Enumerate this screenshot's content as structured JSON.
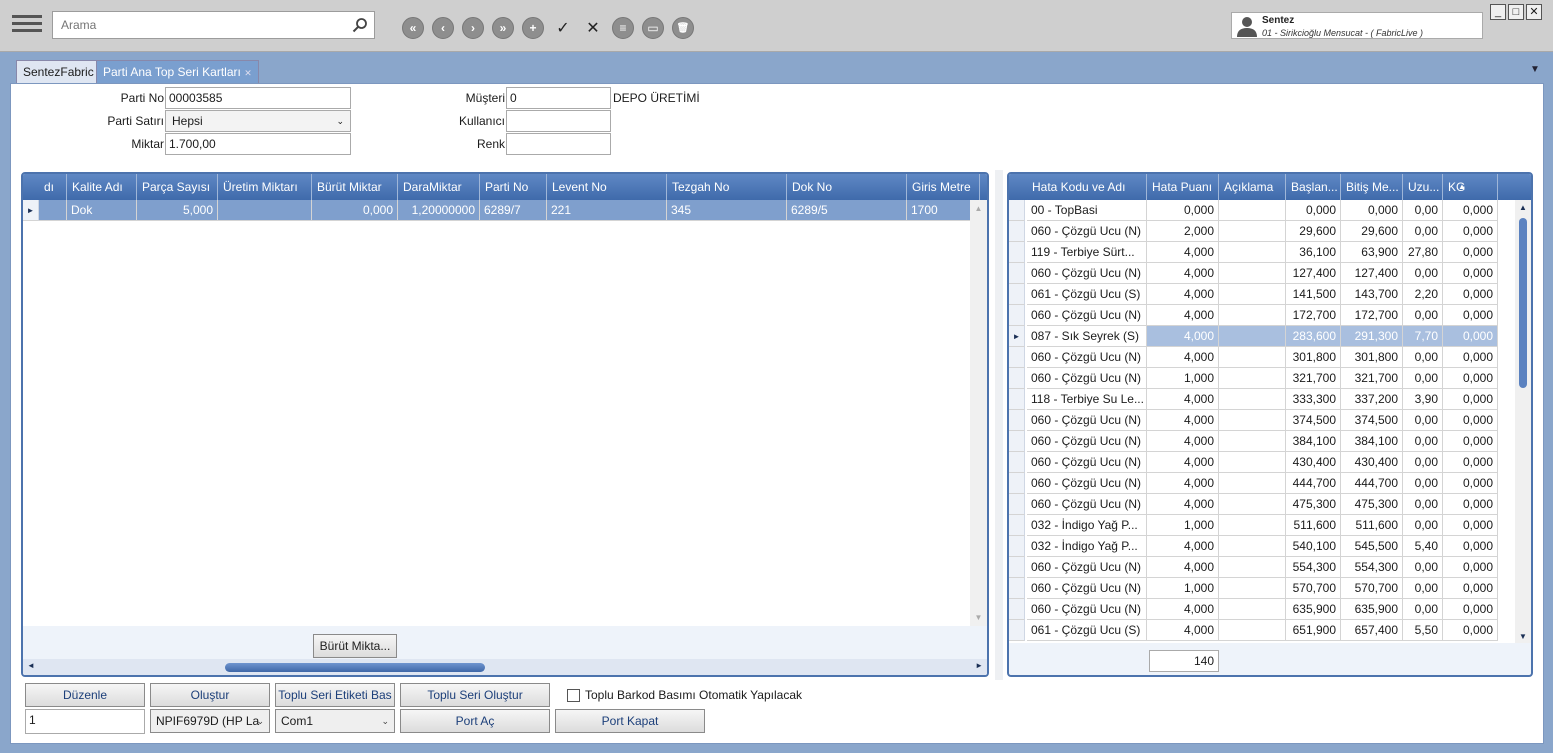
{
  "search": {
    "placeholder": "Arama"
  },
  "toolbar": {
    "first": "«",
    "prev": "‹",
    "next": "›",
    "last": "»",
    "add": "+",
    "confirm": "✓",
    "cancel": "✕",
    "list": "≡",
    "card": "▭",
    "delete": "🗑"
  },
  "user": {
    "name": "Sentez",
    "company": "01 - Sirikcioğlu Mensucat - ( FabricLive )"
  },
  "window": {
    "minimize": "_",
    "maximize": "□",
    "close": "✕"
  },
  "tabs": [
    {
      "label": "SentezFabric"
    },
    {
      "label": "Parti Ana Top Seri Kartları",
      "close": "✕"
    }
  ],
  "tab_dropdown": "▼",
  "form": {
    "parti_no_label": "Parti No",
    "parti_no_value": "00003585",
    "parti_satiri_label": "Parti Satırı",
    "parti_satiri_value": "Hepsi",
    "miktar_label": "Miktar",
    "miktar_value": "1.700,00",
    "musteri_label": "Müşteri",
    "musteri_value": "0",
    "musteri_name": "DEPO ÜRETİMİ",
    "kullanici_label": "Kullanıcı",
    "kullanici_value": "",
    "renk_label": "Renk",
    "renk_value": ""
  },
  "left_grid": {
    "columns": [
      "dı",
      "Kalite Adı",
      "Parça Sayısı",
      "Üretim Miktarı",
      "Bürüt Miktar",
      "DaraMiktar",
      "Parti No",
      "Levent No",
      "Tezgah No",
      "Dok No",
      "Giris Metre"
    ],
    "rows": [
      [
        "",
        "Dok",
        "5,000",
        "",
        "0,000",
        "1,20000000",
        "6289/7",
        "221",
        "345",
        "6289/5",
        "1700"
      ]
    ],
    "footer_button": "Bürüt Mikta..."
  },
  "right_grid": {
    "columns": [
      "Hata Kodu ve Adı",
      "Hata Puanı",
      "Açıklama",
      "Başlan...",
      "Bitiş Me...",
      "Uzu...",
      "KG"
    ],
    "rows": [
      [
        "00 - TopBasi",
        "0,000",
        "",
        "0,000",
        "0,000",
        "0,00",
        "0,000"
      ],
      [
        "060 - Çözgü Ucu (N)",
        "2,000",
        "",
        "29,600",
        "29,600",
        "0,00",
        "0,000"
      ],
      [
        "119 - Terbiye Sürt...",
        "4,000",
        "",
        "36,100",
        "63,900",
        "27,80",
        "0,000"
      ],
      [
        "060 - Çözgü Ucu (N)",
        "4,000",
        "",
        "127,400",
        "127,400",
        "0,00",
        "0,000"
      ],
      [
        "061 - Çözgü Ucu (S)",
        "4,000",
        "",
        "141,500",
        "143,700",
        "2,20",
        "0,000"
      ],
      [
        "060 - Çözgü Ucu (N)",
        "4,000",
        "",
        "172,700",
        "172,700",
        "0,00",
        "0,000"
      ],
      [
        "087 - Sık Seyrek (S)",
        "4,000",
        "",
        "283,600",
        "291,300",
        "7,70",
        "0,000"
      ],
      [
        "060 - Çözgü Ucu (N)",
        "4,000",
        "",
        "301,800",
        "301,800",
        "0,00",
        "0,000"
      ],
      [
        "060 - Çözgü Ucu (N)",
        "1,000",
        "",
        "321,700",
        "321,700",
        "0,00",
        "0,000"
      ],
      [
        "118 - Terbiye Su Le...",
        "4,000",
        "",
        "333,300",
        "337,200",
        "3,90",
        "0,000"
      ],
      [
        "060 - Çözgü Ucu (N)",
        "4,000",
        "",
        "374,500",
        "374,500",
        "0,00",
        "0,000"
      ],
      [
        "060 - Çözgü Ucu (N)",
        "4,000",
        "",
        "384,100",
        "384,100",
        "0,00",
        "0,000"
      ],
      [
        "060 - Çözgü Ucu (N)",
        "4,000",
        "",
        "430,400",
        "430,400",
        "0,00",
        "0,000"
      ],
      [
        "060 - Çözgü Ucu (N)",
        "4,000",
        "",
        "444,700",
        "444,700",
        "0,00",
        "0,000"
      ],
      [
        "060 - Çözgü Ucu (N)",
        "4,000",
        "",
        "475,300",
        "475,300",
        "0,00",
        "0,000"
      ],
      [
        "032 - İndigo Yağ P...",
        "1,000",
        "",
        "511,600",
        "511,600",
        "0,00",
        "0,000"
      ],
      [
        "032 - İndigo Yağ P...",
        "4,000",
        "",
        "540,100",
        "545,500",
        "5,40",
        "0,000"
      ],
      [
        "060 - Çözgü Ucu (N)",
        "4,000",
        "",
        "554,300",
        "554,300",
        "0,00",
        "0,000"
      ],
      [
        "060 - Çözgü Ucu (N)",
        "1,000",
        "",
        "570,700",
        "570,700",
        "0,00",
        "0,000"
      ],
      [
        "060 - Çözgü Ucu (N)",
        "4,000",
        "",
        "635,900",
        "635,900",
        "0,00",
        "0,000"
      ],
      [
        "061 - Çözgü Ucu (S)",
        "4,000",
        "",
        "651,900",
        "657,400",
        "5,50",
        "0,000"
      ]
    ],
    "selected_row": 6,
    "footer_total": "140"
  },
  "bottom": {
    "duzenle": "Düzenle",
    "duzenle_value": "1",
    "olustur": "Oluştur",
    "printer_value": "NPIF6979D (HP La",
    "toplu_seri_etiketi": "Toplu Seri Etiketi Bas",
    "port_value": "Com1",
    "toplu_seri_olustur": "Toplu Seri Oluştur",
    "port_ac": "Port Aç",
    "toplu_barkod_label": "Toplu Barkod Basımı Otomatik Yapılacak",
    "port_kapat": "Port Kapat"
  },
  "icons": {
    "hamburger": "menu-icon",
    "search": "search-icon",
    "user": "user-icon",
    "scroll_up": "▲",
    "scroll_down": "▼",
    "scroll_left": "◄",
    "scroll_right": "►",
    "row_pointer": "►",
    "sort_asc": "▲",
    "combo_arrow": "⌄"
  }
}
